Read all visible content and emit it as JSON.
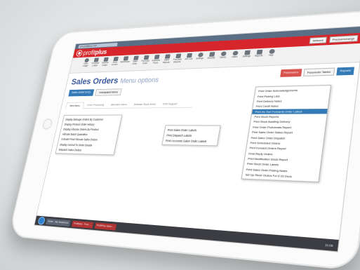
{
  "browser": {
    "tab_title": "pro.profitplus.com"
  },
  "app": {
    "logo_light": "profit",
    "logo_bold": "plus",
    "brand_red": "#d7262b",
    "accent_blue": "#337ab7"
  },
  "header_buttons": [
    "Network",
    "Pressurechange"
  ],
  "toolbar": [
    "Sales Ledger",
    "Purchase Ledger",
    "Nominal Ledger",
    "Stock Control",
    "Warehouse",
    "Sales Order",
    "Purchase Order",
    "Customer Prices",
    "Sales Reports",
    "Purchase Reports",
    "Job Cost",
    "Settings",
    "Security",
    "Clients",
    "Users",
    "Settings",
    "Reports",
    "Help"
  ],
  "page": {
    "title": "Sales Orders",
    "subtitle": "Menu options"
  },
  "actions": {
    "red": "Parameters",
    "plain": "Parameter Tables",
    "blue": "Reports"
  },
  "entry_buttons": {
    "primary": "Sales Order Entry",
    "secondary": "Anticipated Items"
  },
  "tabs": [
    "New Menu",
    "Order Processing",
    "Allocation Menu",
    "Release Stock Items",
    "Print Support"
  ],
  "left_menu": [
    "Display Manage Orders By Customer",
    "Display Product Order History",
    "Display Allocate Orders By Product",
    "Allocate Batch Quantities",
    "Activate Final Allocate Sales Orders",
    "Display Amend To Order Details",
    "Dispatch Sales Orders"
  ],
  "labels_menu": [
    "Print Sales Order Labels",
    "Print Dispatch Labels",
    "Print Accounts Sales Order Labels"
  ],
  "reports_menu": [
    "Print Order Acknowledgements",
    "Print Picking Lists",
    "Print Delivery Notes",
    "Print Credit Notes",
    "Print Inc Sort Forwards Order Labels",
    "Print Stock Reports",
    "Print Stock Awaiting Delivery",
    "Print Order Proformats Report",
    "Print Sales Order Status Report",
    "Print Sales Order Dispatch",
    "Print Scheduled Orders",
    "Print Forward Orders Report",
    "Final Reply Orders",
    "Print Modification Stock Report",
    "Print Stock Order Labels",
    "Print Sales Order Picking Notes",
    "Set Up Stock Orders For E-DI Docs"
  ],
  "reports_highlight_index": 4,
  "taskbar": [
    "Notes - Sky NewsFeed",
    "Profitplus - Prod ...",
    "ProfitPlus Sales ..."
  ],
  "clock": "11:06"
}
